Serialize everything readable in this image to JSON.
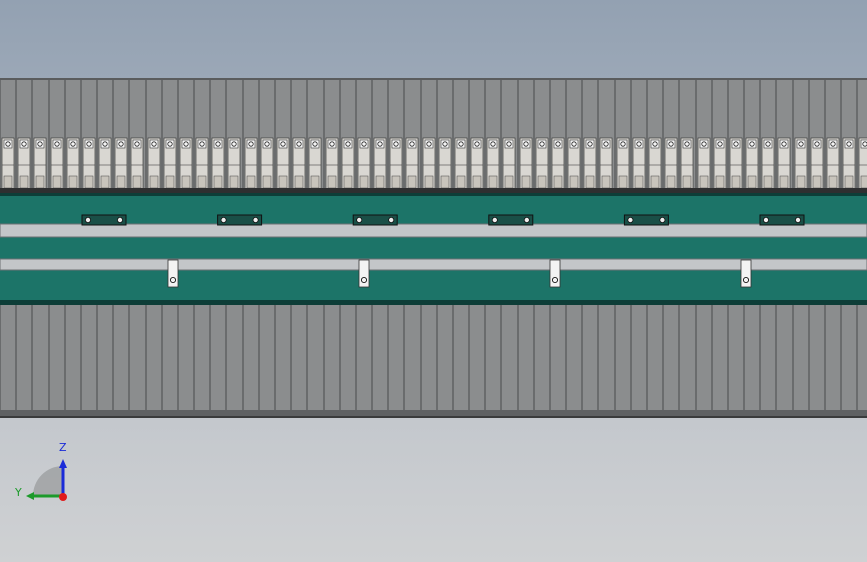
{
  "viewport": {
    "background_top": "#93a1b2",
    "background_bottom": "#cfd1d3"
  },
  "model": {
    "upper_fin_count": 54,
    "lower_fin_count": 54,
    "top_brackets": 6,
    "clips": 4,
    "colors": {
      "fin": "#8b8d8e",
      "fin_dark": "#4a4b4c",
      "conveyor": "#1c7468",
      "rail": "#c3c6c9",
      "white": "#f3f3f3"
    }
  },
  "triad": {
    "z_label": "Z",
    "y_label": "Y",
    "z_color": "#1a2bd8",
    "y_color": "#1c9a2a",
    "x_color": "#e01b1b"
  }
}
